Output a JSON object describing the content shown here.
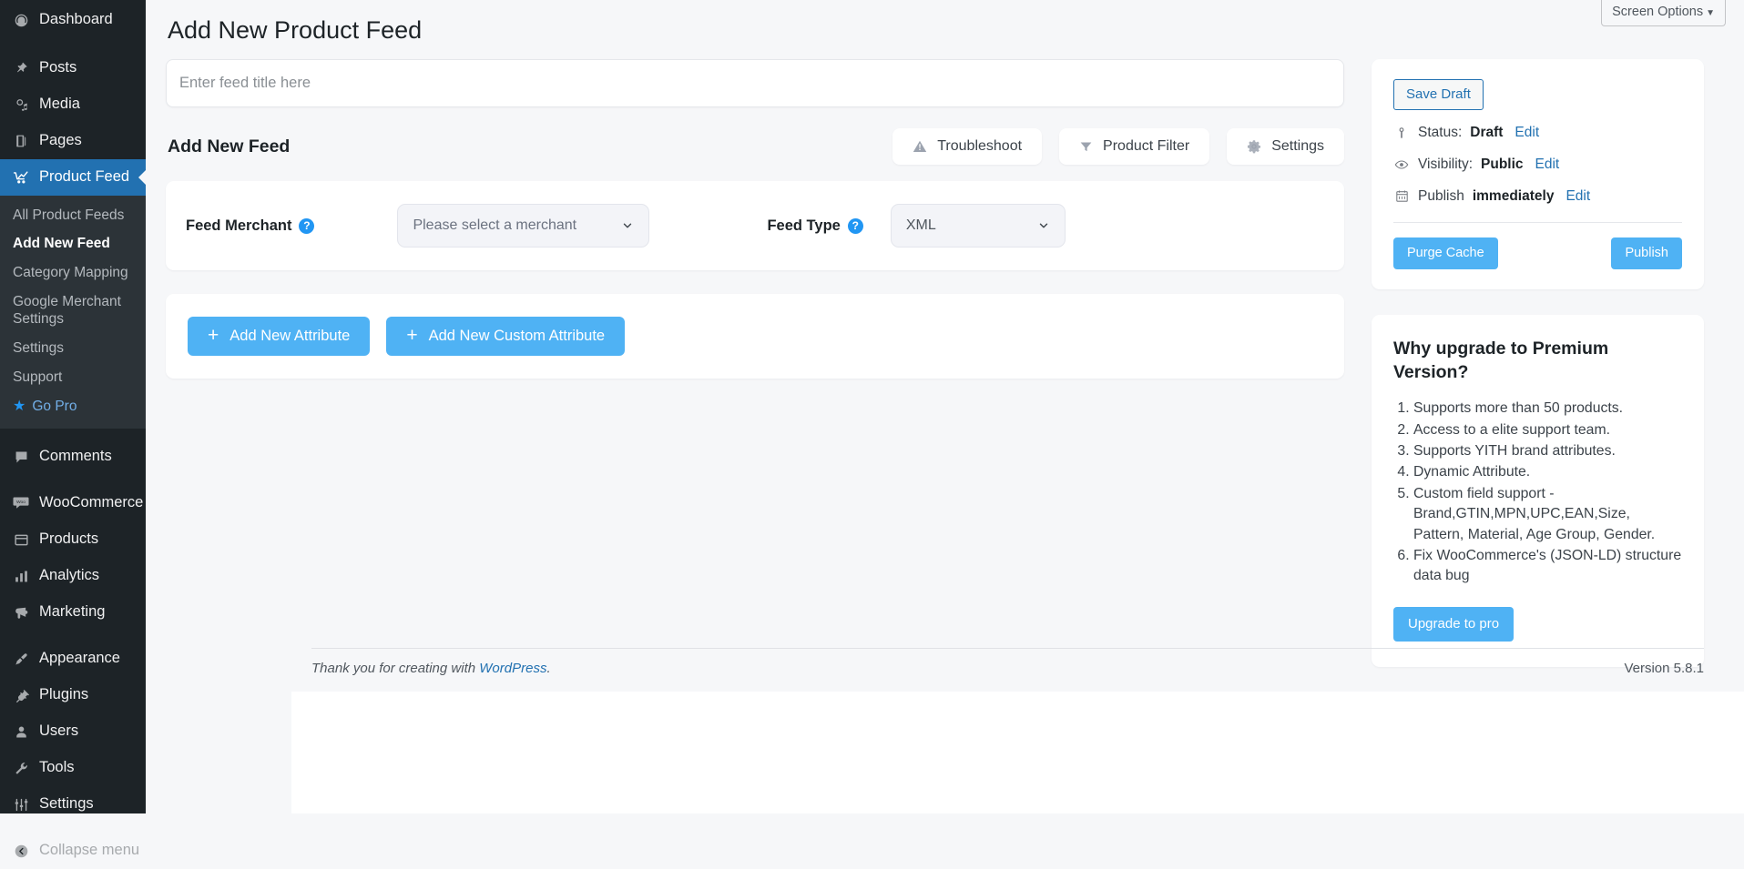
{
  "sidebar": {
    "primary": [
      {
        "label": "Dashboard",
        "icon": "dashboard-icon",
        "name": "sidebar-item-dashboard"
      },
      {
        "label": "Posts",
        "icon": "pin-icon",
        "name": "sidebar-item-posts"
      },
      {
        "label": "Media",
        "icon": "media-icon",
        "name": "sidebar-item-media"
      },
      {
        "label": "Pages",
        "icon": "pages-icon",
        "name": "sidebar-item-pages"
      },
      {
        "label": "Product Feed",
        "icon": "chart-line-icon",
        "name": "sidebar-item-product-feed",
        "active": true
      }
    ],
    "submenu": [
      {
        "label": "All Product Feeds",
        "name": "submenu-item-all-product-feeds"
      },
      {
        "label": "Add New Feed",
        "name": "submenu-item-add-new-feed",
        "current": true
      },
      {
        "label": "Category Mapping",
        "name": "submenu-item-category-mapping"
      },
      {
        "label": "Google Merchant Settings",
        "name": "submenu-item-google-merchant-settings"
      },
      {
        "label": "Settings",
        "name": "submenu-item-settings"
      },
      {
        "label": "Support",
        "name": "submenu-item-support"
      },
      {
        "label": "Go Pro",
        "name": "submenu-item-go-pro",
        "star": true
      }
    ],
    "secondary": [
      {
        "label": "Comments",
        "icon": "comment-icon",
        "name": "sidebar-item-comments"
      }
    ],
    "commerce": [
      {
        "label": "WooCommerce",
        "icon": "woocommerce-icon",
        "name": "sidebar-item-woocommerce"
      },
      {
        "label": "Products",
        "icon": "products-icon",
        "name": "sidebar-item-products"
      },
      {
        "label": "Analytics",
        "icon": "analytics-icon",
        "name": "sidebar-item-analytics"
      },
      {
        "label": "Marketing",
        "icon": "megaphone-icon",
        "name": "sidebar-item-marketing"
      }
    ],
    "system": [
      {
        "label": "Appearance",
        "icon": "brush-icon",
        "name": "sidebar-item-appearance"
      },
      {
        "label": "Plugins",
        "icon": "plug-icon",
        "name": "sidebar-item-plugins"
      },
      {
        "label": "Users",
        "icon": "user-icon",
        "name": "sidebar-item-users"
      },
      {
        "label": "Tools",
        "icon": "wrench-icon",
        "name": "sidebar-item-tools"
      },
      {
        "label": "Settings",
        "icon": "sliders-icon",
        "name": "sidebar-item-settings"
      }
    ],
    "collapse": {
      "label": "Collapse menu",
      "icon": "collapse-icon",
      "name": "sidebar-item-collapse-menu"
    }
  },
  "screen_options": {
    "label": "Screen Options",
    "caret": "▼"
  },
  "page": {
    "title": "Add New Product Feed",
    "section_heading": "Add New Feed"
  },
  "title_field": {
    "placeholder": "Enter feed title here",
    "value": ""
  },
  "toolbar": {
    "troubleshoot_label": "Troubleshoot",
    "product_filter_label": "Product Filter",
    "settings_label": "Settings"
  },
  "feed_config": {
    "merchant_label": "Feed Merchant",
    "merchant_value": "Please select a merchant",
    "merchant_help": "?",
    "feed_type_label": "Feed Type",
    "feed_type_value": "XML",
    "feed_type_help": "?",
    "feed_type_options": [
      "XML"
    ]
  },
  "attributes": {
    "add_attribute_label": "Add New Attribute",
    "add_custom_attribute_label": "Add New Custom Attribute",
    "plus": "+"
  },
  "publish_box": {
    "save_draft_label": "Save Draft",
    "status_prefix": "Status:",
    "status_value": "Draft",
    "status_edit": "Edit",
    "visibility_prefix": "Visibility:",
    "visibility_value": "Public",
    "visibility_edit": "Edit",
    "publish_prefix": "Publish",
    "publish_value": "immediately",
    "publish_edit": "Edit",
    "purge_cache_label": "Purge Cache",
    "publish_label": "Publish"
  },
  "premium": {
    "title": "Why upgrade to Premium Version?",
    "items": [
      "Supports more than 50 products.",
      "Access to a elite support team.",
      "Supports YITH brand attributes.",
      "Dynamic Attribute.",
      "Custom field support - Brand,GTIN,MPN,UPC,EAN,Size, Pattern, Material, Age Group, Gender.",
      "Fix WooCommerce's (JSON-LD) structure data bug"
    ],
    "upgrade_label": "Upgrade to pro"
  },
  "footer": {
    "thanks_prefix": "Thank you for creating with ",
    "wordpress_link": "WordPress",
    "thanks_suffix": ".",
    "version": "Version 5.8.1"
  },
  "colors": {
    "sidebar_bg": "#1d2327",
    "submenu_bg": "#2c3338",
    "active_blue": "#2271b1",
    "accent_blue": "#4fb2f4",
    "link_blue": "#2271b1",
    "page_bg": "#f6f7f9"
  }
}
